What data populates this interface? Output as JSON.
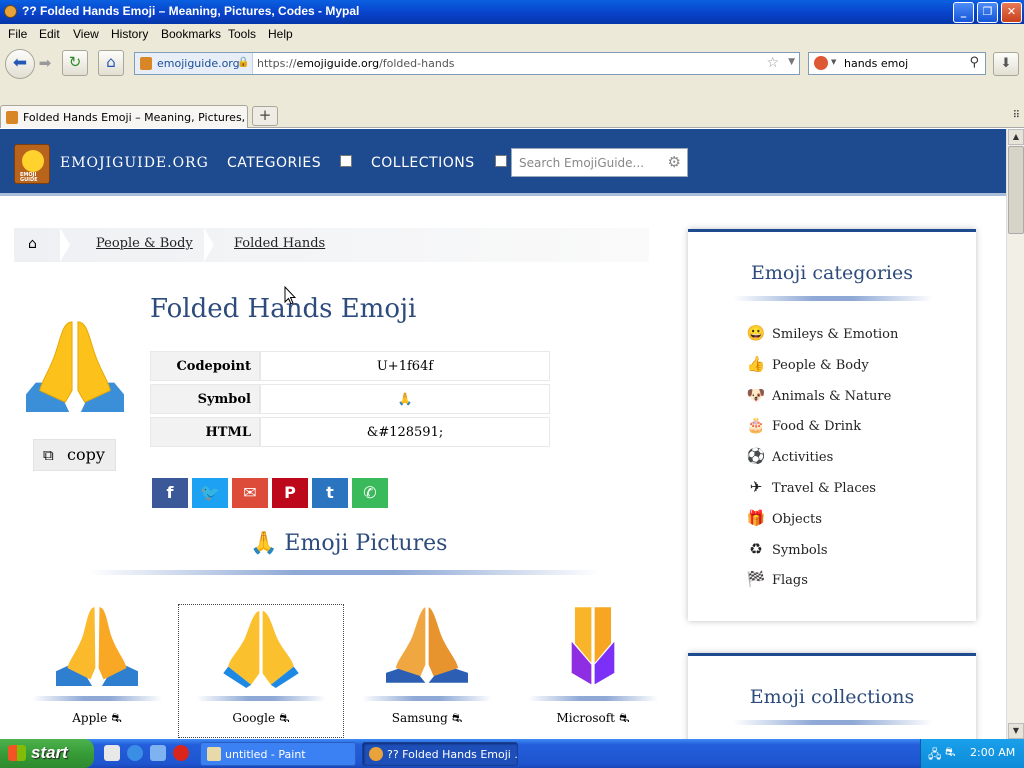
{
  "window": {
    "title": "?? Folded Hands Emoji – Meaning, Pictures, Codes - Mypal"
  },
  "menu": [
    "File",
    "Edit",
    "View",
    "History",
    "Bookmarks",
    "Tools",
    "Help"
  ],
  "urlbar": {
    "site": "emojiguide.org",
    "url_prefix": "https://",
    "url_domain": "emojiguide.org",
    "url_path": "/folded-hands"
  },
  "search": {
    "value": "hands emoj"
  },
  "tabs": [
    {
      "label": "Folded Hands Emoji – Meaning, Pictures, ..."
    }
  ],
  "site": {
    "brand": "EMOJIGUIDE.ORG",
    "logo_text": "EMOJI GUIDE",
    "nav": [
      "CATEGORIES",
      "COLLECTIONS"
    ],
    "search_placeholder": "Search EmojiGuide..."
  },
  "breadcrumb": [
    "People & Body",
    "Folded Hands"
  ],
  "emoji": {
    "title": "Folded Hands Emoji",
    "copy_label": "copy",
    "table": [
      {
        "key": "Codepoint",
        "value": "U+1f64f"
      },
      {
        "key": "Symbol",
        "value": "🙏"
      },
      {
        "key": "HTML",
        "value": "&#128591;"
      }
    ]
  },
  "share_buttons": [
    {
      "name": "facebook",
      "glyph": "f",
      "color": "#3b5998"
    },
    {
      "name": "twitter",
      "glyph": "🐦",
      "color": "#1da1f2"
    },
    {
      "name": "email",
      "glyph": "✉",
      "color": "#dd4b39"
    },
    {
      "name": "pinterest",
      "glyph": "P",
      "color": "#bd081c"
    },
    {
      "name": "tumblr",
      "glyph": "t",
      "color": "#2a74c0"
    },
    {
      "name": "whatsapp",
      "glyph": "✆",
      "color": "#3bba5b"
    }
  ],
  "pictures": {
    "heading_icon": "🙏",
    "heading": "Emoji Pictures",
    "vendors": [
      "Apple",
      "Google",
      "Samsung",
      "Microsoft"
    ]
  },
  "sidebar": {
    "categories_title": "Emoji categories",
    "categories": [
      {
        "icon": "😀",
        "label": "Smileys & Emotion"
      },
      {
        "icon": "👍",
        "label": "People & Body"
      },
      {
        "icon": "🐶",
        "label": "Animals & Nature"
      },
      {
        "icon": "🎂",
        "label": "Food & Drink"
      },
      {
        "icon": "⚽",
        "label": "Activities"
      },
      {
        "icon": "✈",
        "label": "Travel & Places"
      },
      {
        "icon": "🎁",
        "label": "Objects"
      },
      {
        "icon": "♻",
        "label": "Symbols"
      },
      {
        "icon": "🏁",
        "label": "Flags"
      }
    ],
    "collections_title": "Emoji collections"
  },
  "taskbar": {
    "start": "start",
    "tasks": [
      "untitled - Paint",
      "?? Folded Hands Emoji ..."
    ],
    "clock": "2:00 AM"
  }
}
